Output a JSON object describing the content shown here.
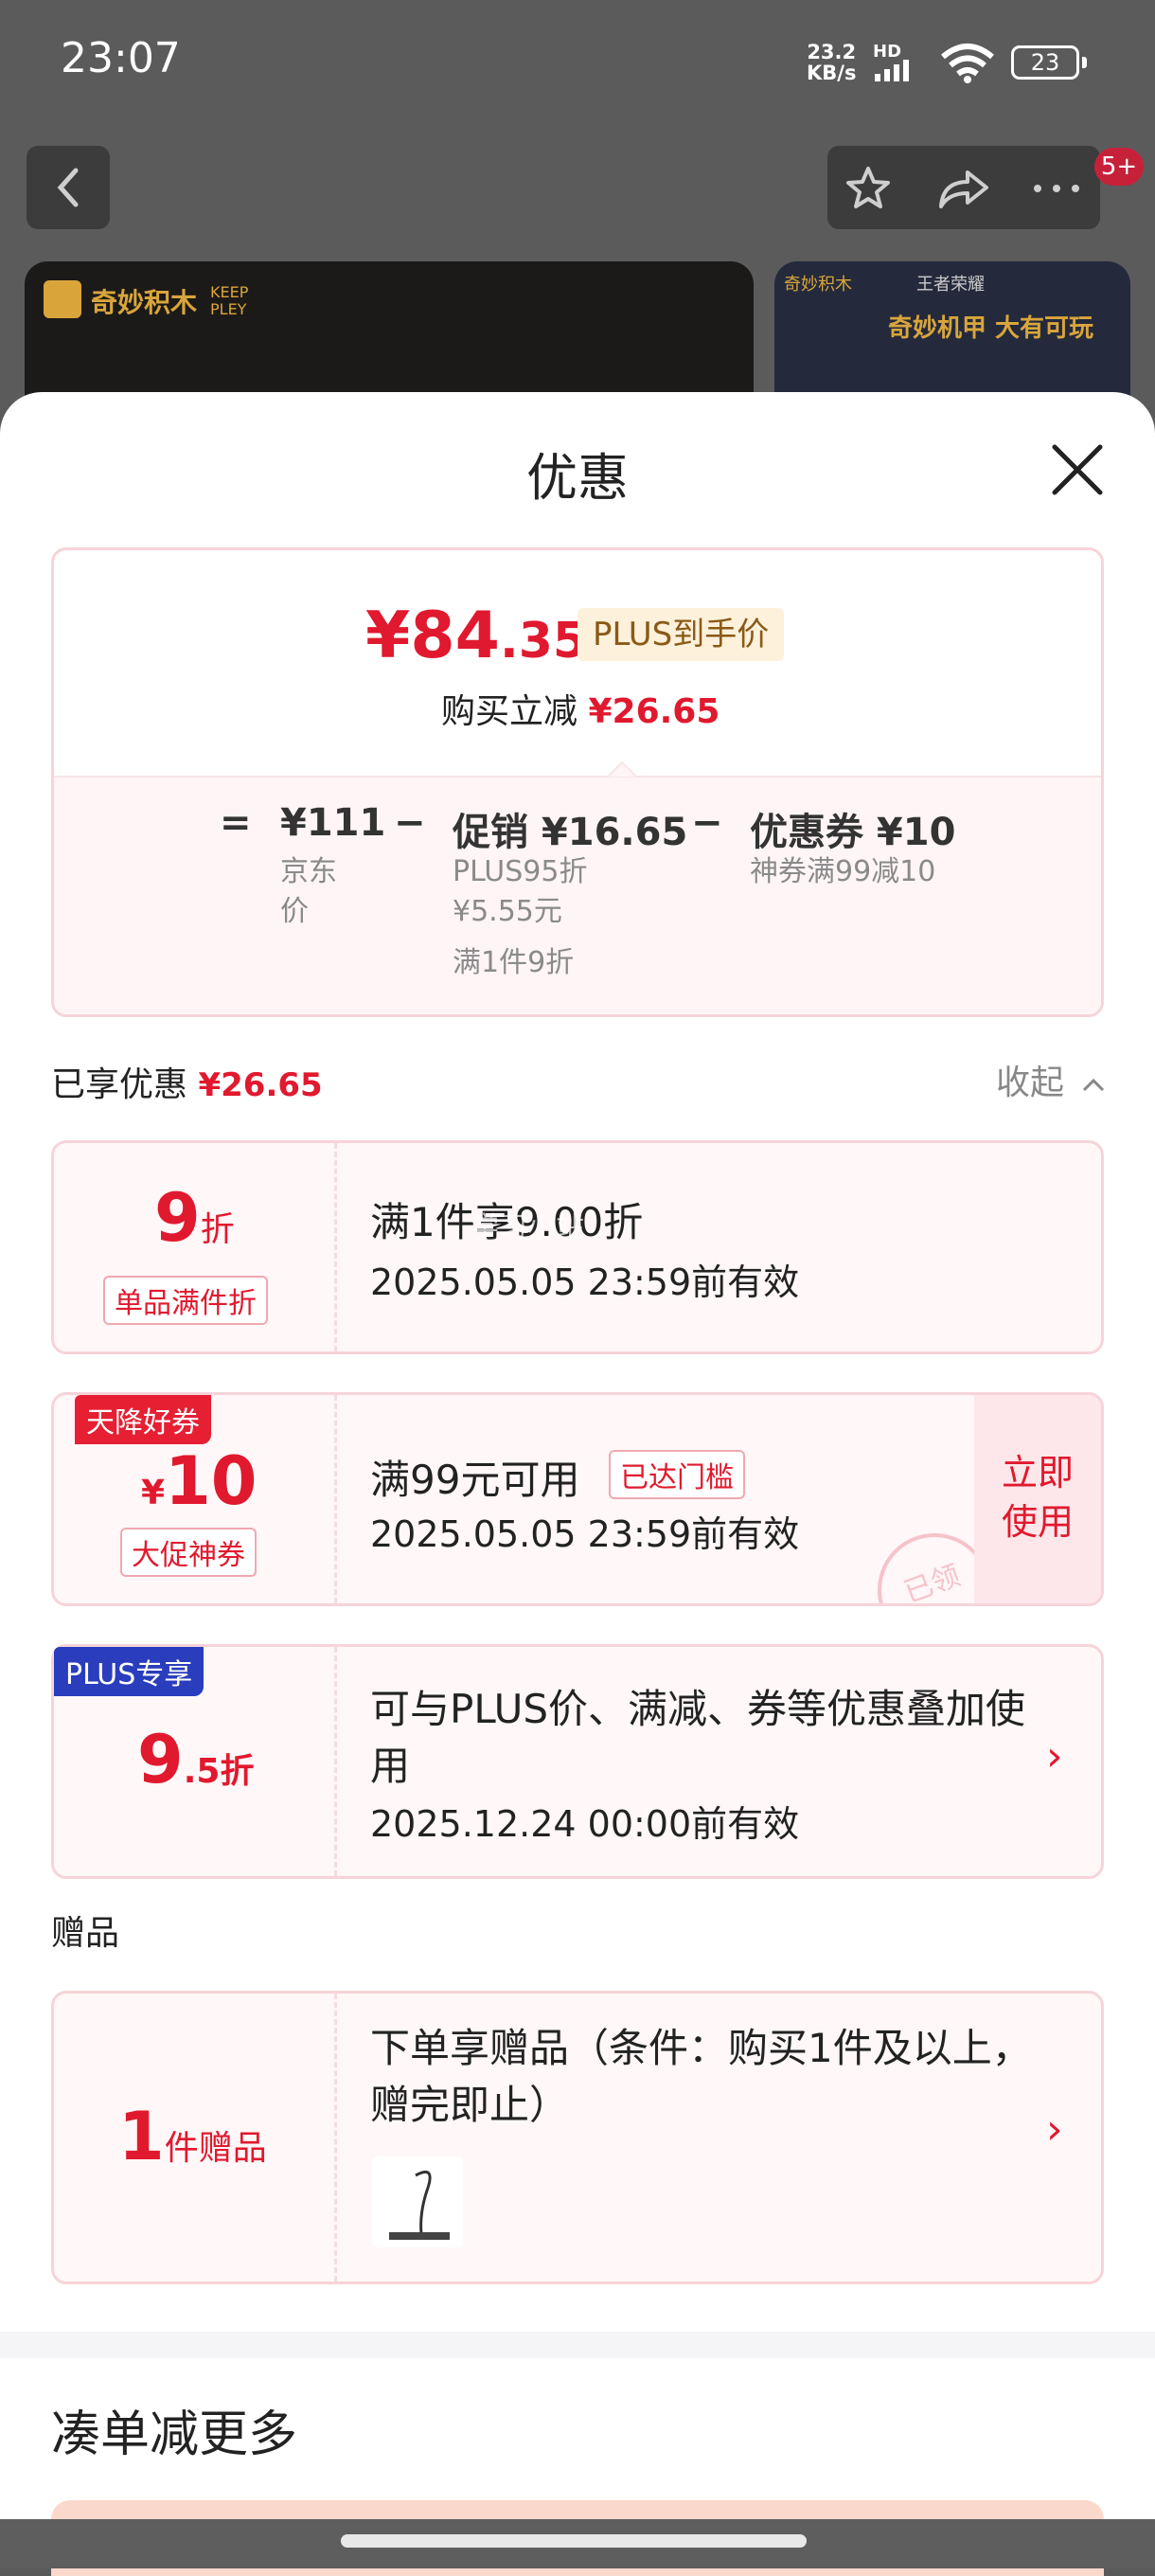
{
  "status": {
    "time": "23:07",
    "speed": "23.2",
    "speed_unit": "KB/s",
    "hd": "HD",
    "battery": "23"
  },
  "top": {
    "notif_badge": "5+"
  },
  "banners": {
    "left_brand": "奇妙积木",
    "left_sub": "KEEP PLEY",
    "right_brand": "奇妙积木",
    "right_co": "王者荣耀",
    "right_slogan": "奇妙机甲 大有可玩"
  },
  "sheet": {
    "title": "优惠"
  },
  "summary": {
    "currency": "¥",
    "price_int": "84",
    "price_dec": ".35",
    "plus_tag": "PLUS到手价",
    "reduce_label": "购买立减",
    "reduce_amount": "¥26.65",
    "eq": "=",
    "minus": "−",
    "jd_price": "¥111",
    "jd_label": "京东价",
    "promo": "促销 ¥16.65",
    "promo_sub1": "PLUS95折",
    "promo_sub2": "¥5.55元",
    "promo_sub3": "满1件9折",
    "coupon": "优惠券 ¥10",
    "coupon_sub": "神券满99减10"
  },
  "enjoyed": {
    "label": "已享优惠",
    "amount": "¥26.65",
    "collapse": "收起"
  },
  "cards": [
    {
      "num": "9",
      "unit": "折",
      "pill": "单品满件折",
      "title": "满1件享9.00折",
      "date": "2025.05.05 23:59前有效"
    },
    {
      "corner": "天降好券",
      "currency": "¥",
      "num": "10",
      "pill": "大促神券",
      "title": "满99元可用",
      "tag": "已达门槛",
      "date": "2025.05.05 23:59前有效",
      "action": "立即使用",
      "stamp": "已领"
    },
    {
      "corner": "PLUS专享",
      "num": "9",
      "unit": ".5折",
      "title": "可与PLUS价、满减、券等优惠叠加使用",
      "date": "2025.12.24 00:00前有效"
    }
  ],
  "gift": {
    "section": "赠品",
    "num": "1",
    "unit": "件赠品",
    "title": "下单享赠品（条件：购买1件及以上，赠完即止）"
  },
  "more": {
    "title": "凑单减更多"
  },
  "watermark": "学习小站"
}
